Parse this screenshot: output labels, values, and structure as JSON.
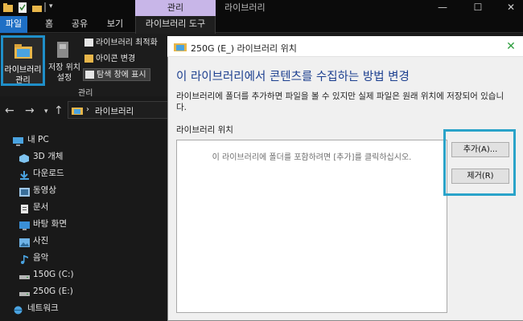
{
  "window": {
    "title": "라이브러리",
    "context_tab": "관리",
    "controls": [
      "—",
      "☐",
      "✕"
    ]
  },
  "ribbon": {
    "tabs": [
      "파일",
      "홈",
      "공유",
      "보기",
      "라이브러리 도구"
    ],
    "manage_library_label": [
      "라이브러리",
      "관리"
    ],
    "save_location_label": [
      "저장 위치",
      "설정"
    ],
    "commands": [
      "라이브러리 최적화",
      "아이콘 변경",
      "탐색 창에 표시"
    ],
    "group_label": "관리"
  },
  "address": {
    "path": "라이브러리"
  },
  "nav_pane": {
    "items": [
      {
        "label": "내 PC",
        "icon": "pc-icon"
      },
      {
        "label": "3D 개체",
        "icon": "cube-icon"
      },
      {
        "label": "다운로드",
        "icon": "download-icon"
      },
      {
        "label": "동영상",
        "icon": "video-icon"
      },
      {
        "label": "문서",
        "icon": "document-icon"
      },
      {
        "label": "바탕 화면",
        "icon": "desktop-icon"
      },
      {
        "label": "사진",
        "icon": "picture-icon"
      },
      {
        "label": "음악",
        "icon": "music-icon"
      },
      {
        "label": "150G (C:)",
        "icon": "drive-icon"
      },
      {
        "label": "250G (E:)",
        "icon": "drive-icon"
      },
      {
        "label": "네트워크",
        "icon": "network-icon"
      }
    ]
  },
  "dialog": {
    "title": "250G (E_) 라이브러리 위치",
    "heading": "이 라이브러리에서 콘텐츠를 수집하는 방법 변경",
    "description": "라이브러리에 폴더를 추가하면 파일을 볼 수 있지만 실제 파일은 원래 위치에 저장되어 있습니다.",
    "location_label": "라이브러리 위치",
    "empty_hint": "이 라이브러리에 폴더를 포함하려면 [추가]를 클릭하십시오.",
    "add_button": "추가(A)...",
    "remove_button": "제거(R)",
    "close": "✕"
  },
  "colors": {
    "accent_blue": "#1e6fc5",
    "highlight": "#2aa3c9",
    "context_tab": "#c8b6e8",
    "dialog_heading": "#1c3f8f",
    "dialog_close_green": "#2e9e3f"
  }
}
